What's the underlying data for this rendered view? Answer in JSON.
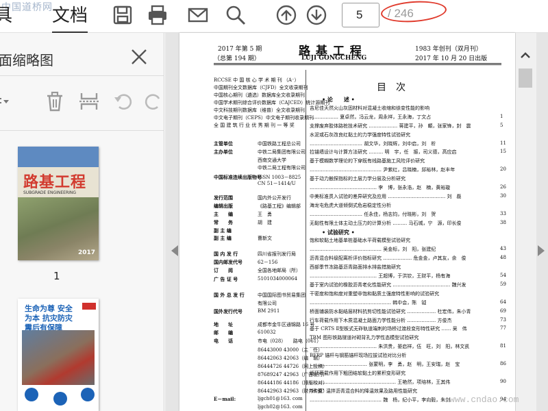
{
  "toolbar": {
    "tabs": [
      {
        "label": "具"
      },
      {
        "label": "文档"
      }
    ],
    "logo_text": "中国道桥网",
    "current_page": "5",
    "total_pages": "/ 246",
    "accent": "#e03a2c"
  },
  "sidebar": {
    "title": "面缩略图",
    "thumb_labels": [
      "1"
    ],
    "cover": {
      "title": "路基工程",
      "subtitle": "SUBGRADE ENGINEERING",
      "year": "2017"
    },
    "ad": {
      "headline": "生命为尊 安全为本 抗灾防灾 震后有保障"
    }
  },
  "document": {
    "header": {
      "year_issue": "2017 年第 5 期",
      "total_issue": "（总第 194 期）",
      "journal_cn": "路 基 工 程",
      "journal_en": "LUJI   GONGCHENG",
      "founded": "1983 年创刊（双月刊）",
      "published": "2017 年 10 月 20 日出版"
    },
    "left_notes": [
      "RCCSE 中 国 核 心 学 术 期 刊 （A⁻）",
      "中国期刊全文数据库（CJFD）全文收录期刊",
      "中国核心期刊（遴选）数据库全文收录期刊",
      "中国学术期刊综合评价数据库（CAJCED）统计源期刊",
      "中文科技期刊数据库（维普）全文收录期刊",
      "中文电子期刊（CEPS）中文电子期刊收录期刊",
      "全 国 建 筑 行 业 优 秀 期 刊 一 等 奖"
    ],
    "masthead": [
      {
        "k": "主管单位",
        "v": "中国铁路工程总公司"
      },
      {
        "k": "主办单位",
        "v": "中铁二局集团有限公司"
      },
      {
        "k": "",
        "v": "西南交通大学"
      },
      {
        "k": "",
        "v": "中铁二局工程有限公司"
      },
      {
        "k": "中国标准连续出版物号",
        "v": "ISSN 1003－8825"
      },
      {
        "k": "",
        "v": "CN 51－1414/U"
      },
      {
        "k": "发行范围",
        "v": "国内外公开发行"
      },
      {
        "k": "编辑出版",
        "v": "《路基工程》编辑部"
      },
      {
        "k": "主　　编",
        "v": "王　勇"
      },
      {
        "k": "常　　务",
        "v": "胡　建"
      },
      {
        "k": "副 主 编",
        "v": ""
      },
      {
        "k": "副 主 编",
        "v": "曹新文"
      },
      {
        "k": "国 内 发 行",
        "v": "四川省报刊发行局"
      },
      {
        "k": "国内邮发代号",
        "v": "62－156"
      },
      {
        "k": "订　　阅",
        "v": "全国各地邮局（所）"
      },
      {
        "k": "广 告 证 号",
        "v": "5101034000064"
      },
      {
        "k": "国 外 总 发 行",
        "v": "中国国际图书贸易集团"
      },
      {
        "k": "",
        "v": "有限公司"
      },
      {
        "k": "国外发行代号",
        "v": "BM 2911"
      },
      {
        "k": "地　　址",
        "v": "成都市金牛区通锦路 16 号"
      },
      {
        "k": "邮　　编",
        "v": "610032"
      },
      {
        "k": "电　　话",
        "v": "市电（028）　　路电（061）"
      },
      {
        "k": "",
        "v": "86443000  43000（主　任）"
      },
      {
        "k": "",
        "v": "86442063  42063（编　辑）"
      },
      {
        "k": "",
        "v": "86444726  44726（网上投稿）"
      },
      {
        "k": "",
        "v": "87689247  42963（广告发行）"
      },
      {
        "k": "",
        "v": "86444186  44186（排版校对）"
      },
      {
        "k": "",
        "v": "86442963  42963（财务传真）"
      },
      {
        "k": "E－mail:",
        "v": "ljgch01@163. com"
      },
      {
        "k": "",
        "v": "ljgch02@163. com"
      }
    ],
    "toc_heading": "目　次",
    "toc": [
      {
        "t": "• 论　　述 •",
        "p": "",
        "section": true
      },
      {
        "t": "吉尼佳天然火山灰固材料对混凝土收缩和徐变性能的影响",
        "p": ""
      },
      {
        "t": "……………… 夏卓然，冯云龙，周永祥，王永海，丁文占",
        "p": "1"
      },
      {
        "t": "支撑废弃胶体路桩技术研究 ……………… 蒋建平，孙　頔，张家锋，封　震",
        "p": "5"
      },
      {
        "t": "水泥或石灰改良红黏土的力学强度特性试验研究",
        "p": ""
      },
      {
        "t": "…………………………… 胡文华，刘晓辉，刘中启，刘　析",
        "p": "11"
      },
      {
        "t": "拉锚墙设计与计算方法研究 ……… 明　宇，任　振，司义德，高应启",
        "p": "15"
      },
      {
        "t": "基于模糊数学理论的下穿既有线路基施工风险评价研究",
        "p": ""
      },
      {
        "t": "……………………………………… 尹紫红，吕晓楠，邱裕林，赵丰年",
        "p": "20"
      },
      {
        "t": "基于动力触探指标的土层力学分层及分析研究",
        "p": ""
      },
      {
        "t": "…………………………………… 李　博，张永浩，赵　楠，黄裕璇",
        "p": "26"
      },
      {
        "t": "中美标准贯入试验的差异研究及应用 ……………………………… 刘　磊",
        "p": "30"
      },
      {
        "t": "海龙屯危虎大道倾倒式危岩稳定性分析",
        "p": ""
      },
      {
        "t": "…………………………… 任永佳，杨志钧，付晓彬，刘　贺",
        "p": "33"
      },
      {
        "t": "无黏性有限土体主动土压力的计算分析 ……… 马石城，宁　源，印长俊",
        "p": "38"
      },
      {
        "t": "• 试验研究 •",
        "p": "",
        "section": true
      },
      {
        "t": "饱和软黏土地基单桩基础水平荷载模型试验研究",
        "p": ""
      },
      {
        "t": "……………………………………… 吴金标，刘　阳，张建纪",
        "p": "43"
      },
      {
        "t": "沥青混合料级配离析评价指标研究 ……………… 危金金，卢其友，余　俊",
        "p": "48"
      },
      {
        "t": "西部季节冻路基沥青路面排水排盐措施研究",
        "p": ""
      },
      {
        "t": "…………………………………… 王超博，于洪钦，王财平，杨有海",
        "p": "54"
      },
      {
        "t": "基于室内试验的橡胶沥青老化性能研究 ……………………………… 魏兴发",
        "p": "59"
      },
      {
        "t": "干密度和饱和度对重塑非饱和黏质土强度特性影响的试验研究",
        "p": ""
      },
      {
        "t": "…………………………………………… 韩中会，陈　钺",
        "p": "64"
      },
      {
        "t": "桥面铺装防水黏结层材料抗剪切性能试验研究 ……………… 杜宏伟，朱小青",
        "p": "69"
      },
      {
        "t": "行车荷载作用下木质混凝土路面力学性能分析 ……………… 方俊杰",
        "p": "73"
      },
      {
        "t": "基于 CRTS Ⅱ型板式无砟轨道端刺的场桥过渡段变形特性研究 …… 吴　伟",
        "p": "77"
      },
      {
        "t": "TBM 图形铁路隧道衬砌背孔力学性态模型试验研究",
        "p": ""
      },
      {
        "t": "…………………………………… 朱洪贵，晏启祥，伍　旺，刘　阳，林文凯",
        "p": "81"
      },
      {
        "t": "BFRP 锚杆与钢筋锚杆现场拉拔试验对比分析",
        "p": ""
      },
      {
        "t": "……………………………… 张蒙明，李　勇，赵　明，王安瑞，赵　宝",
        "p": "86"
      },
      {
        "t": "循环荷载作用下粗团结软黏土的累积变形研究",
        "p": ""
      },
      {
        "t": "……………………………………………… 王艳然，项培林，王其伟",
        "p": "90"
      },
      {
        "t": "\"H 型\" 温拌沥青混合料的降温效果及路用性能研究",
        "p": ""
      },
      {
        "t": "……………………………………… 魏　杨，纪小平，李向毅，朱剑",
        "p": "94"
      }
    ],
    "watermark": "www.cndao.com"
  }
}
